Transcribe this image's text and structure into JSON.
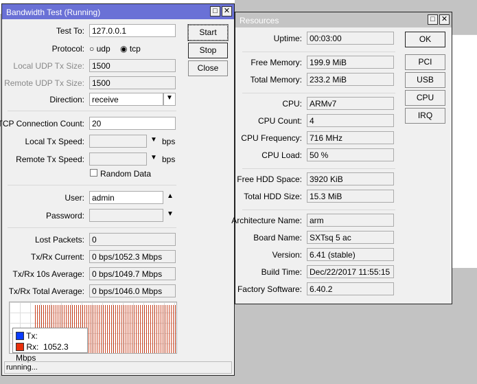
{
  "bw": {
    "title": "Bandwidth Test (Running)",
    "buttons": {
      "start": "Start",
      "stop": "Stop",
      "close": "Close"
    },
    "test_to_label": "Test To:",
    "test_to": "127.0.0.1",
    "protocol_label": "Protocol:",
    "udp": "udp",
    "tcp": "tcp",
    "protocol_selected": "tcp",
    "local_udp_label": "Local UDP Tx Size:",
    "local_udp": "1500",
    "remote_udp_label": "Remote UDP Tx Size:",
    "remote_udp": "1500",
    "direction_label": "Direction:",
    "direction": "receive",
    "tcp_count_label": "TCP Connection Count:",
    "tcp_count": "20",
    "local_speed_label": "Local Tx Speed:",
    "remote_speed_label": "Remote Tx Speed:",
    "bps": "bps",
    "random_data": "Random Data",
    "user_label": "User:",
    "user": "admin",
    "password_label": "Password:",
    "lost_label": "Lost Packets:",
    "lost": "0",
    "current_label": "Tx/Rx Current:",
    "current": "0 bps/1052.3 Mbps",
    "avg10_label": "Tx/Rx 10s Average:",
    "avg10": "0 bps/1049.7 Mbps",
    "total_label": "Tx/Rx Total Average:",
    "total": "0 bps/1046.0 Mbps",
    "legend": {
      "tx": "Tx:",
      "rx": "Rx:",
      "rx_value": "1052.3 Mbps",
      "tx_color": "#0a3cff",
      "rx_color": "#e8300c"
    },
    "status": "running..."
  },
  "res": {
    "title": "Resources",
    "buttons": [
      "OK",
      "PCI",
      "USB",
      "CPU",
      "IRQ"
    ],
    "rows": [
      {
        "label": "Uptime:",
        "value": "00:03:00"
      },
      {
        "label": "Free Memory:",
        "value": "199.9 MiB"
      },
      {
        "label": "Total Memory:",
        "value": "233.2 MiB"
      },
      {
        "label": "CPU:",
        "value": "ARMv7"
      },
      {
        "label": "CPU Count:",
        "value": "4"
      },
      {
        "label": "CPU Frequency:",
        "value": "716 MHz"
      },
      {
        "label": "CPU Load:",
        "value": "50 %"
      },
      {
        "label": "Free HDD Space:",
        "value": "3920 KiB"
      },
      {
        "label": "Total HDD Size:",
        "value": "15.3 MiB"
      },
      {
        "label": "Architecture Name:",
        "value": "arm"
      },
      {
        "label": "Board Name:",
        "value": "SXTsq 5 ac"
      },
      {
        "label": "Version:",
        "value": "6.41 (stable)"
      },
      {
        "label": "Build Time:",
        "value": "Dec/22/2017 11:55:15"
      },
      {
        "label": "Factory Software:",
        "value": "6.40.2"
      }
    ]
  }
}
